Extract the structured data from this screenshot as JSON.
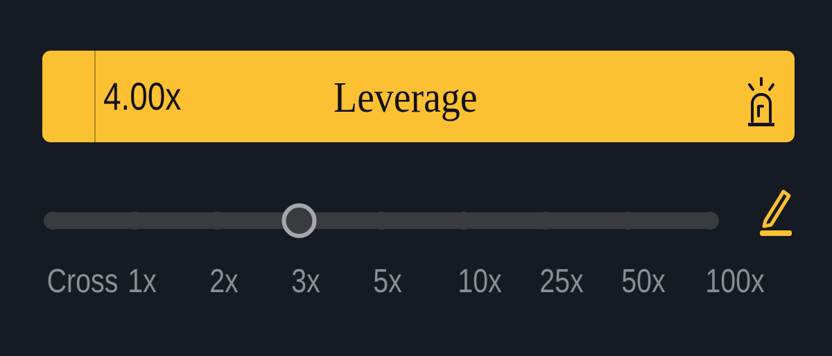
{
  "leverage_bar": {
    "value": "4.00x",
    "title": "Leverage",
    "accent_color": "#fcc133",
    "icon": "alarm-light-icon"
  },
  "slider": {
    "ticks": [
      "Cross",
      "1x",
      "2x",
      "3x",
      "5x",
      "10x",
      "25x",
      "50x",
      "100x"
    ],
    "selected_tick": "3x",
    "track_color": "#3a3b3e",
    "thumb_color": "#a5a7ab",
    "edit_icon": "pencil-icon"
  },
  "colors": {
    "background": "#151a23",
    "label": "#8b8e94"
  }
}
